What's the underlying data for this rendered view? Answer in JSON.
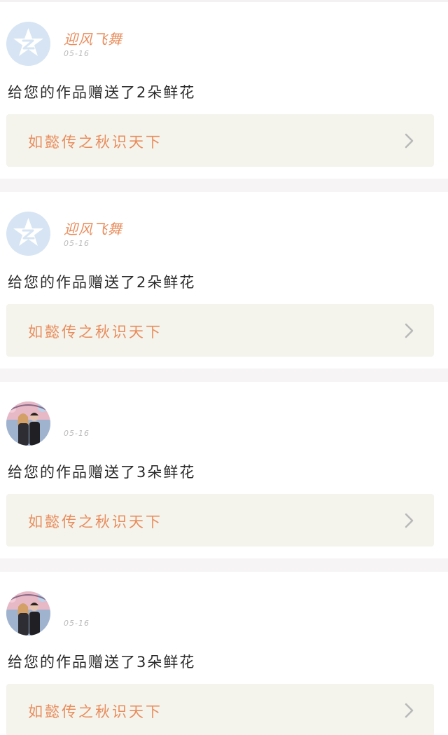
{
  "notifications": [
    {
      "username": "迎风飞舞",
      "time": "05-16",
      "message": "给您的作品赠送了2朵鲜花",
      "work_title": "如懿传之秋识天下",
      "avatar": "qzone-star-avatar"
    },
    {
      "username": "迎风飞舞",
      "time": "05-16",
      "message": "给您的作品赠送了2朵鲜花",
      "work_title": "如懿传之秋识天下",
      "avatar": "qzone-star-avatar"
    },
    {
      "username": "",
      "time": "05-16",
      "message": "给您的作品赠送了3朵鲜花",
      "work_title": "如懿传之秋识天下",
      "avatar": "couple-photo-avatar"
    },
    {
      "username": "",
      "time": "05-16",
      "message": "给您的作品赠送了3朵鲜花",
      "work_title": "如懿传之秋识天下",
      "avatar": "couple-photo-avatar"
    }
  ],
  "colors": {
    "accent": "#e98c5b",
    "link_bg": "#f4f4ed",
    "separator": "#f6f4f4",
    "avatar_blue": "#d6e4f3"
  },
  "icons": {
    "chevron": "chevron-right-icon"
  }
}
